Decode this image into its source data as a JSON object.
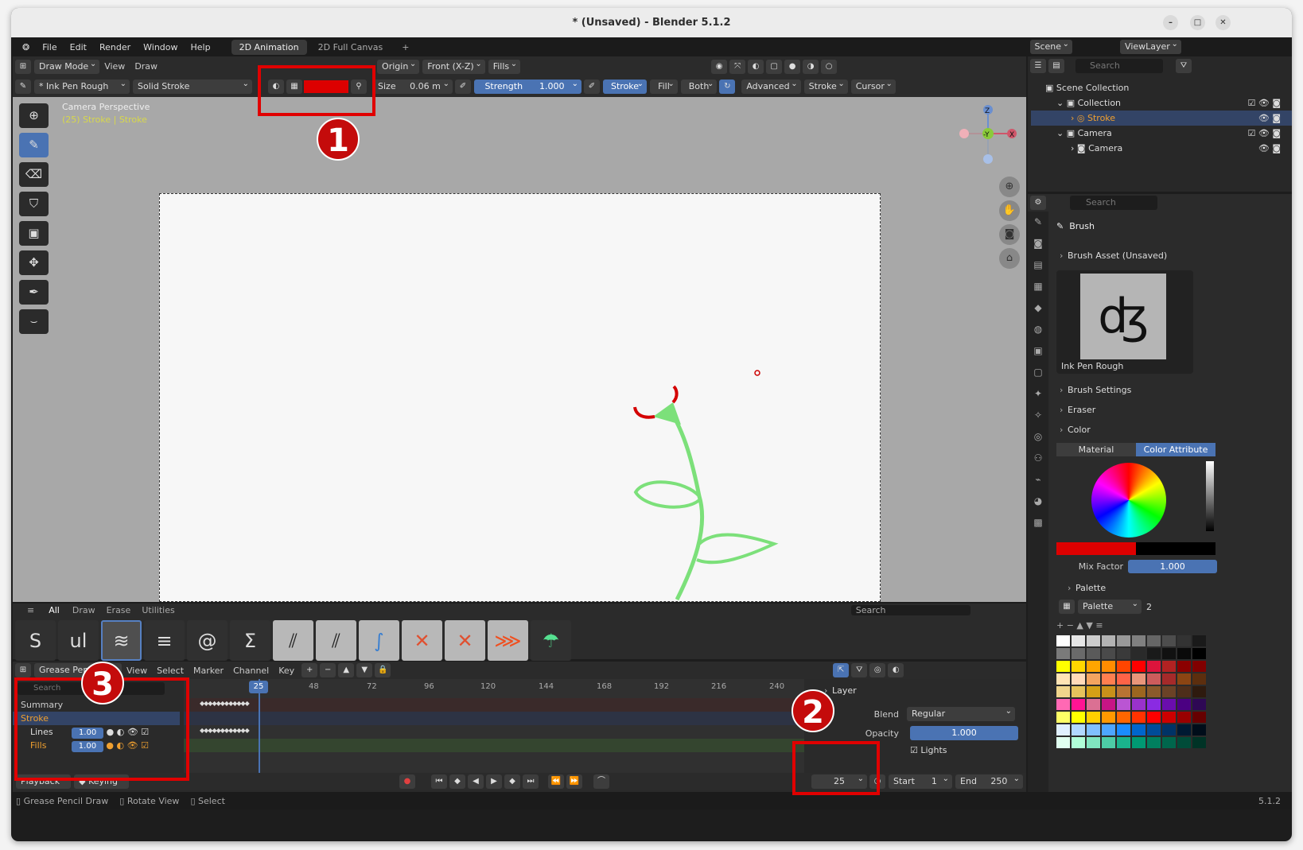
{
  "window": {
    "title": "* (Unsaved) - Blender 5.1.2"
  },
  "menu": {
    "items": [
      "File",
      "Edit",
      "Render",
      "Window",
      "Help"
    ],
    "workspaces": [
      "2D Animation",
      "2D Full Canvas"
    ],
    "add": "+",
    "scene": "Scene",
    "view_layer": "ViewLayer"
  },
  "header": {
    "mode": "Draw Mode",
    "view": "View",
    "draw": "Draw",
    "pivot": "Origin",
    "orient": "Front (X-Z)",
    "fills": "Fills"
  },
  "toolsettings": {
    "brush": "* Ink Pen Rough",
    "material": "Solid Stroke",
    "size_label": "Size",
    "size_value": "0.06 m",
    "strength_label": "Strength",
    "strength_value": "1.000",
    "stroke": "Stroke",
    "fill": "Fill",
    "both": "Both",
    "advanced": "Advanced",
    "stroke_dd": "Stroke",
    "cursor": "Cursor",
    "color": "#dd0000"
  },
  "viewport": {
    "perspective": "Camera Perspective",
    "info": "(25) Stroke | Stroke",
    "gizmo": {
      "z": "Z",
      "y": "-Y",
      "x": "X"
    }
  },
  "annotations": {
    "badge1": "1",
    "badge2": "2",
    "badge3": "3"
  },
  "outliner": {
    "search": "Search",
    "root": "Scene Collection",
    "collection": "Collection",
    "stroke": "Stroke",
    "camera_coll": "Camera",
    "camera": "Camera"
  },
  "properties": {
    "search": "Search",
    "brush": "Brush",
    "asset_panel": "Brush Asset (Unsaved)",
    "brush_name": "Ink Pen Rough",
    "brush_settings": "Brush Settings",
    "eraser": "Eraser",
    "color": "Color",
    "tab_material": "Material",
    "tab_attr": "Color Attribute",
    "mix_label": "Mix Factor",
    "mix_value": "1.000",
    "palette_panel": "Palette",
    "palette_name": "Palette",
    "palette_users": "2"
  },
  "assets": {
    "tabs": [
      "All",
      "Draw",
      "Erase",
      "Utilities"
    ],
    "search": "Search",
    "icons": [
      "S",
      "ul",
      "≋",
      "≡",
      "@",
      "Ʃ",
      "⫽",
      "⫽",
      "∫",
      "✕",
      "✕",
      "⋙",
      "☂"
    ]
  },
  "timeline": {
    "editor": "Grease Pencil",
    "menus": [
      "View",
      "Select",
      "Marker",
      "Channel",
      "Key"
    ],
    "search": "Search",
    "summary": "Summary",
    "stroke": "Stroke",
    "lines": "Lines",
    "fills": "Fills",
    "lines_val": "1.00",
    "fills_val": "1.00",
    "frame_current": "25",
    "ticks": [
      "48",
      "72",
      "96",
      "120",
      "144",
      "168",
      "192",
      "216",
      "240"
    ],
    "playback": "Playback",
    "keying": "Keying",
    "frame_field": "25",
    "start_label": "Start",
    "start_value": "1",
    "end_label": "End",
    "end_value": "250"
  },
  "layer_panel": {
    "title": "Layer",
    "blend_label": "Blend",
    "blend_value": "Regular",
    "opacity_label": "Opacity",
    "opacity_value": "1.000",
    "lights": "Lights"
  },
  "status": {
    "a": "Grease Pencil Draw",
    "b": "Rotate View",
    "c": "Select",
    "version": "5.1.2"
  },
  "palette_colors": [
    "#ffffff",
    "#e6e6e6",
    "#cccccc",
    "#b3b3b3",
    "#999999",
    "#808080",
    "#666666",
    "#4d4d4d",
    "#333333",
    "#1a1a1a",
    "#7a7a7a",
    "#6a6a6a",
    "#5a5a5a",
    "#4a4a4a",
    "#3a3a3a",
    "#2a2a2a",
    "#1a1a1a",
    "#111111",
    "#0a0a0a",
    "#000000",
    "#ffff00",
    "#ffd700",
    "#ffa500",
    "#ff8c00",
    "#ff4500",
    "#ff0000",
    "#dc143c",
    "#b22222",
    "#8b0000",
    "#800000",
    "#ffe4b5",
    "#ffdab9",
    "#f4a460",
    "#ff7f50",
    "#ff6347",
    "#e9967a",
    "#cd5c5c",
    "#a52a2a",
    "#8b4513",
    "#5c2e0e",
    "#f0d58c",
    "#e6c35c",
    "#d4a017",
    "#c8901a",
    "#b87333",
    "#9c661f",
    "#8b5a2b",
    "#6b4226",
    "#4e2e1a",
    "#2e1a0e",
    "#ff69b4",
    "#ff1493",
    "#db7093",
    "#c71585",
    "#ba55d3",
    "#9932cc",
    "#8a2be2",
    "#6a0dad",
    "#4b0082",
    "#2e0854",
    "#ffff66",
    "#ffff00",
    "#ffd000",
    "#ff9900",
    "#ff6600",
    "#ff3300",
    "#ff0000",
    "#cc0000",
    "#990000",
    "#660000",
    "#e0f0ff",
    "#b0d8ff",
    "#80c0ff",
    "#4da6ff",
    "#1a8cff",
    "#0066cc",
    "#004c99",
    "#003366",
    "#001a33",
    "#000d1a",
    "#e0fff0",
    "#b0ffd8",
    "#80e6c0",
    "#4dcca6",
    "#1ab38c",
    "#009973",
    "#007f5f",
    "#00664c",
    "#004c39",
    "#003326"
  ]
}
